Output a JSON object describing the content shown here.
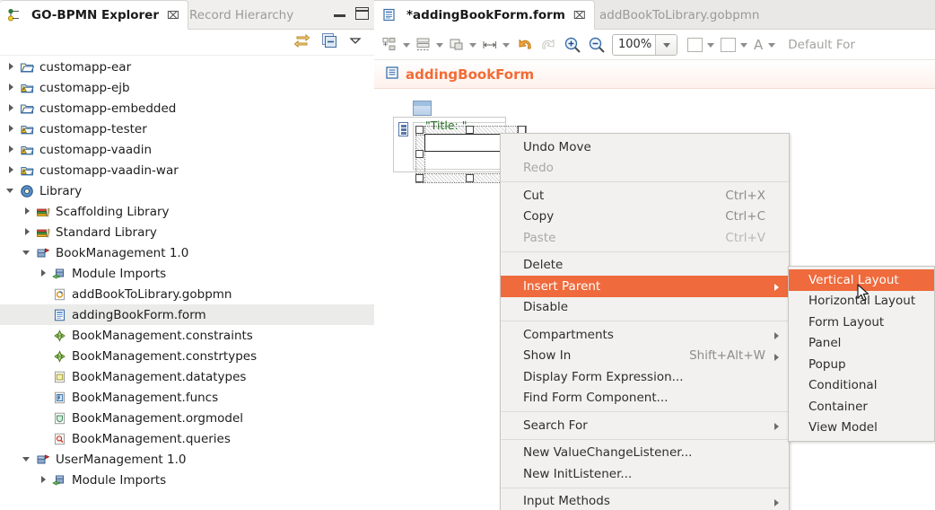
{
  "explorer": {
    "tabs": [
      {
        "label": "GO-BPMN Explorer",
        "icon": "gobpmn-explorer-icon",
        "active": true,
        "close": "⌧"
      },
      {
        "label": "Record Hierarchy",
        "icon": "record-hierarchy-icon",
        "active": false,
        "close": "⌧"
      }
    ],
    "window_buttons": {
      "minimize": "minimize-view-button",
      "maximize": "maximize-view-button"
    },
    "toolbar": [
      {
        "name": "link-with-editor-icon"
      },
      {
        "name": "collapse-all-icon"
      },
      {
        "name": "view-menu-chevron-icon"
      }
    ],
    "tree": [
      {
        "label": "customapp-ear",
        "indent": 0,
        "arrow": "closed",
        "icon": "folder-project-icon"
      },
      {
        "label": "customapp-ejb",
        "indent": 0,
        "arrow": "closed",
        "icon": "warning-project-icon"
      },
      {
        "label": "customapp-embedded",
        "indent": 0,
        "arrow": "closed",
        "icon": "folder-project-icon"
      },
      {
        "label": "customapp-tester",
        "indent": 0,
        "arrow": "closed",
        "icon": "warning-project-icon"
      },
      {
        "label": "customapp-vaadin",
        "indent": 0,
        "arrow": "closed",
        "icon": "warning-project-icon"
      },
      {
        "label": "customapp-vaadin-war",
        "indent": 0,
        "arrow": "closed",
        "icon": "warning-project-icon"
      },
      {
        "label": "Library",
        "indent": 0,
        "arrow": "open",
        "icon": "library-icon"
      },
      {
        "label": "Scaffolding Library",
        "indent": 1,
        "arrow": "closed",
        "icon": "books-icon"
      },
      {
        "label": "Standard Library",
        "indent": 1,
        "arrow": "closed",
        "icon": "books-icon"
      },
      {
        "label": "BookManagement 1.0",
        "indent": 1,
        "arrow": "open",
        "icon": "module-icon"
      },
      {
        "label": "Module Imports",
        "indent": 2,
        "arrow": "closed",
        "icon": "module-imports-icon"
      },
      {
        "label": "addBookToLibrary.gobpmn",
        "indent": 2,
        "arrow": "none",
        "icon": "gobpmn-file-icon"
      },
      {
        "label": "addingBookForm.form",
        "indent": 2,
        "arrow": "none",
        "icon": "form-file-icon",
        "selected": true
      },
      {
        "label": "BookManagement.constraints",
        "indent": 2,
        "arrow": "none",
        "icon": "constraints-icon"
      },
      {
        "label": "BookManagement.constrtypes",
        "indent": 2,
        "arrow": "none",
        "icon": "constraints-icon"
      },
      {
        "label": "BookManagement.datatypes",
        "indent": 2,
        "arrow": "none",
        "icon": "datatypes-icon"
      },
      {
        "label": "BookManagement.funcs",
        "indent": 2,
        "arrow": "none",
        "icon": "funcs-icon"
      },
      {
        "label": "BookManagement.orgmodel",
        "indent": 2,
        "arrow": "none",
        "icon": "orgmodel-icon"
      },
      {
        "label": "BookManagement.queries",
        "indent": 2,
        "arrow": "none",
        "icon": "queries-icon"
      },
      {
        "label": "UserManagement 1.0",
        "indent": 1,
        "arrow": "open",
        "icon": "module-icon"
      },
      {
        "label": "Module Imports",
        "indent": 2,
        "arrow": "closed",
        "icon": "module-imports-icon"
      }
    ]
  },
  "editor": {
    "tabs": [
      {
        "label": "*addingBookForm.form",
        "icon": "form-file-icon",
        "active": true,
        "close": "⌧"
      },
      {
        "label": "addBookToLibrary.gobpmn",
        "icon": "gobpmn-file-icon",
        "active": false,
        "close": "⌧"
      }
    ],
    "toolbar": {
      "align_icon": "align-tool-icon",
      "distribute_icon": "distribute-tool-icon",
      "match_size_icon": "match-size-tool-icon",
      "set_width_icon": "set-width-tool-icon",
      "undo_icon": "undo-icon",
      "redo_icon": "redo-icon",
      "zoom_in_icon": "zoom-in-icon",
      "zoom_out_icon": "zoom-out-icon",
      "zoom_value": "100%",
      "fill_color_icon": "fill-color-swatch",
      "line_color_icon": "line-color-swatch",
      "font_icon": "font-letter-icon",
      "font_name": "Default For"
    },
    "header": {
      "icon": "form-file-icon",
      "title": "addingBookForm"
    },
    "canvas": {
      "vertical_layout_icon": "vertical-layout-icon",
      "widget_icon": "form-widget-icon",
      "title_label": "\"Title: \"",
      "textfield": "form-textfield"
    }
  },
  "context_menu": {
    "groups": [
      [
        {
          "label": "Undo Move",
          "accel": "",
          "disabled": false,
          "submenu": false
        },
        {
          "label": "Redo",
          "accel": "",
          "disabled": true,
          "submenu": false
        }
      ],
      [
        {
          "label": "Cut",
          "accel": "Ctrl+X",
          "disabled": false,
          "submenu": false
        },
        {
          "label": "Copy",
          "accel": "Ctrl+C",
          "disabled": false,
          "submenu": false
        },
        {
          "label": "Paste",
          "accel": "Ctrl+V",
          "disabled": true,
          "submenu": false
        }
      ],
      [
        {
          "label": "Delete",
          "accel": "",
          "disabled": false,
          "submenu": false
        },
        {
          "label": "Insert Parent",
          "accel": "",
          "disabled": false,
          "submenu": true,
          "highlight": true
        },
        {
          "label": "Disable",
          "accel": "",
          "disabled": false,
          "submenu": false
        }
      ],
      [
        {
          "label": "Compartments",
          "accel": "",
          "disabled": false,
          "submenu": true
        },
        {
          "label": "Show In",
          "accel": "Shift+Alt+W",
          "disabled": false,
          "submenu": true
        },
        {
          "label": "Display Form Expression...",
          "accel": "",
          "disabled": false,
          "submenu": false
        },
        {
          "label": "Find Form Component...",
          "accel": "",
          "disabled": false,
          "submenu": false
        }
      ],
      [
        {
          "label": "Search For",
          "accel": "",
          "disabled": false,
          "submenu": true
        }
      ],
      [
        {
          "label": "New ValueChangeListener...",
          "accel": "",
          "disabled": false,
          "submenu": false
        },
        {
          "label": "New InitListener...",
          "accel": "",
          "disabled": false,
          "submenu": false
        }
      ],
      [
        {
          "label": "Input Methods",
          "accel": "",
          "disabled": false,
          "submenu": true
        }
      ]
    ]
  },
  "submenu": {
    "items": [
      {
        "label": "Vertical Layout",
        "highlight": true
      },
      {
        "label": "Horizontal Layout",
        "highlight": false
      },
      {
        "label": "Form Layout",
        "highlight": false
      },
      {
        "label": "Panel",
        "highlight": false
      },
      {
        "label": "Popup",
        "highlight": false
      },
      {
        "label": "Conditional",
        "highlight": false
      },
      {
        "label": "Container",
        "highlight": false
      },
      {
        "label": "View Model",
        "highlight": false
      }
    ]
  },
  "colors": {
    "accent_orange": "#ef6a3c",
    "header_title": "#f26b35",
    "selection_gray": "#ebebe9",
    "menu_bg": "#f2f1ef",
    "tab_inactive_text": "#9a9a97"
  }
}
